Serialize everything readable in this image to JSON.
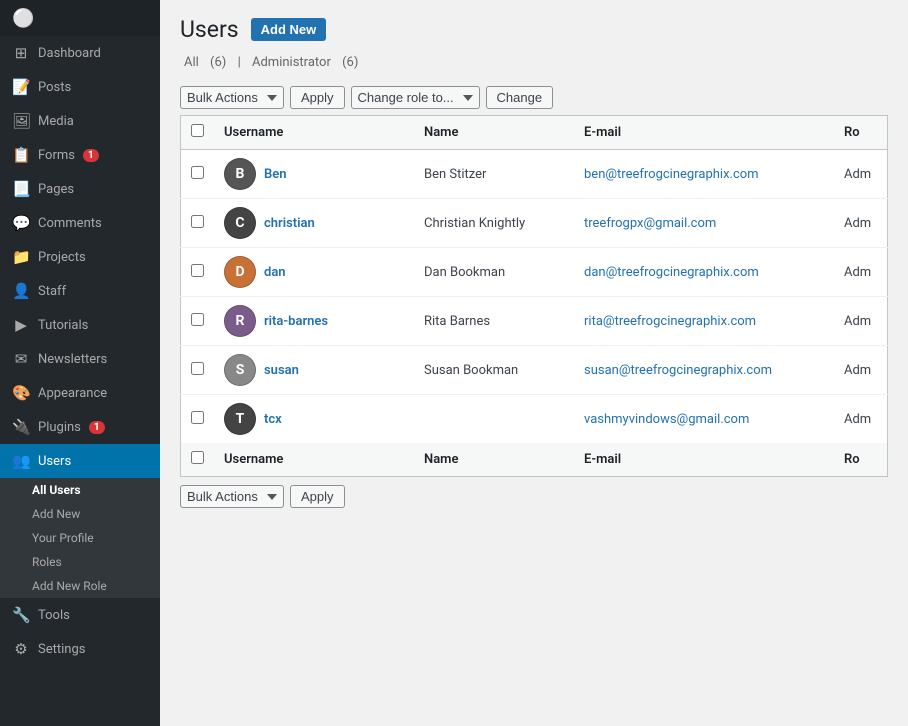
{
  "sidebar": {
    "items": [
      {
        "id": "dashboard",
        "label": "Dashboard",
        "icon": "⊞",
        "active": false
      },
      {
        "id": "posts",
        "label": "Posts",
        "icon": "📄",
        "active": false
      },
      {
        "id": "media",
        "label": "Media",
        "icon": "🖼",
        "active": false
      },
      {
        "id": "forms",
        "label": "Forms",
        "icon": "📋",
        "active": false,
        "badge": "1"
      },
      {
        "id": "pages",
        "label": "Pages",
        "icon": "📃",
        "active": false
      },
      {
        "id": "comments",
        "label": "Comments",
        "icon": "💬",
        "active": false
      },
      {
        "id": "projects",
        "label": "Projects",
        "icon": "📁",
        "active": false
      },
      {
        "id": "staff",
        "label": "Staff",
        "icon": "👤",
        "active": false
      },
      {
        "id": "tutorials",
        "label": "Tutorials",
        "icon": "▶",
        "active": false
      },
      {
        "id": "newsletters",
        "label": "Newsletters",
        "icon": "✉",
        "active": false
      },
      {
        "id": "appearance",
        "label": "Appearance",
        "icon": "🎨",
        "active": false
      },
      {
        "id": "plugins",
        "label": "Plugins",
        "icon": "🔌",
        "active": false,
        "badge": "1"
      },
      {
        "id": "users",
        "label": "Users",
        "icon": "👥",
        "active": true
      },
      {
        "id": "tools",
        "label": "Tools",
        "icon": "🔧",
        "active": false
      },
      {
        "id": "settings",
        "label": "Settings",
        "icon": "⚙",
        "active": false
      }
    ]
  },
  "users_submenu": [
    {
      "id": "all-users",
      "label": "All Users",
      "active": true
    },
    {
      "id": "add-new",
      "label": "Add New",
      "active": false
    },
    {
      "id": "your-profile",
      "label": "Your Profile",
      "active": false
    },
    {
      "id": "roles",
      "label": "Roles",
      "active": false
    },
    {
      "id": "add-new-role",
      "label": "Add New Role",
      "active": false
    }
  ],
  "page": {
    "title": "Users",
    "add_new_label": "Add New"
  },
  "filters": {
    "all_label": "All",
    "all_count": "(6)",
    "separator": "|",
    "admin_label": "Administrator",
    "admin_count": "(6)"
  },
  "toolbar": {
    "bulk_actions_label": "Bulk Actions",
    "apply_label": "Apply",
    "change_role_label": "Change role to...",
    "change_label": "Change"
  },
  "table": {
    "columns": [
      "Username",
      "Name",
      "E-mail",
      "Ro"
    ],
    "rows": [
      {
        "id": "ben",
        "username": "Ben",
        "name": "Ben Stitzer",
        "email": "ben@treefrogcinegraphix.com",
        "role": "Adm",
        "avatar_color": "#555",
        "avatar_text": "B"
      },
      {
        "id": "christian",
        "username": "christian",
        "name": "Christian Knightly",
        "email": "treefrogpx@gmail.com",
        "role": "Adm",
        "avatar_color": "#444",
        "avatar_text": "C"
      },
      {
        "id": "dan",
        "username": "dan",
        "name": "Dan Bookman",
        "email": "dan@treefrogcinegraphix.com",
        "role": "Adm",
        "avatar_color": "#c87137",
        "avatar_text": "D"
      },
      {
        "id": "rita-barnes",
        "username": "rita-barnes",
        "name": "Rita Barnes",
        "email": "rita@treefrogcinegraphix.com",
        "role": "Adm",
        "avatar_color": "#7a5c8a",
        "avatar_text": "R"
      },
      {
        "id": "susan",
        "username": "susan",
        "name": "Susan Bookman",
        "email": "susan@treefrogcinegraphix.com",
        "role": "Adm",
        "avatar_color": "#888",
        "avatar_text": "S"
      },
      {
        "id": "tcx",
        "username": "tcx",
        "name": "",
        "email": "vashmyvindows@gmail.com",
        "role": "Adm",
        "avatar_color": "#444",
        "avatar_text": "T"
      }
    ]
  },
  "bottom_toolbar": {
    "bulk_actions_label": "Bulk Actions",
    "apply_label": "Apply"
  }
}
